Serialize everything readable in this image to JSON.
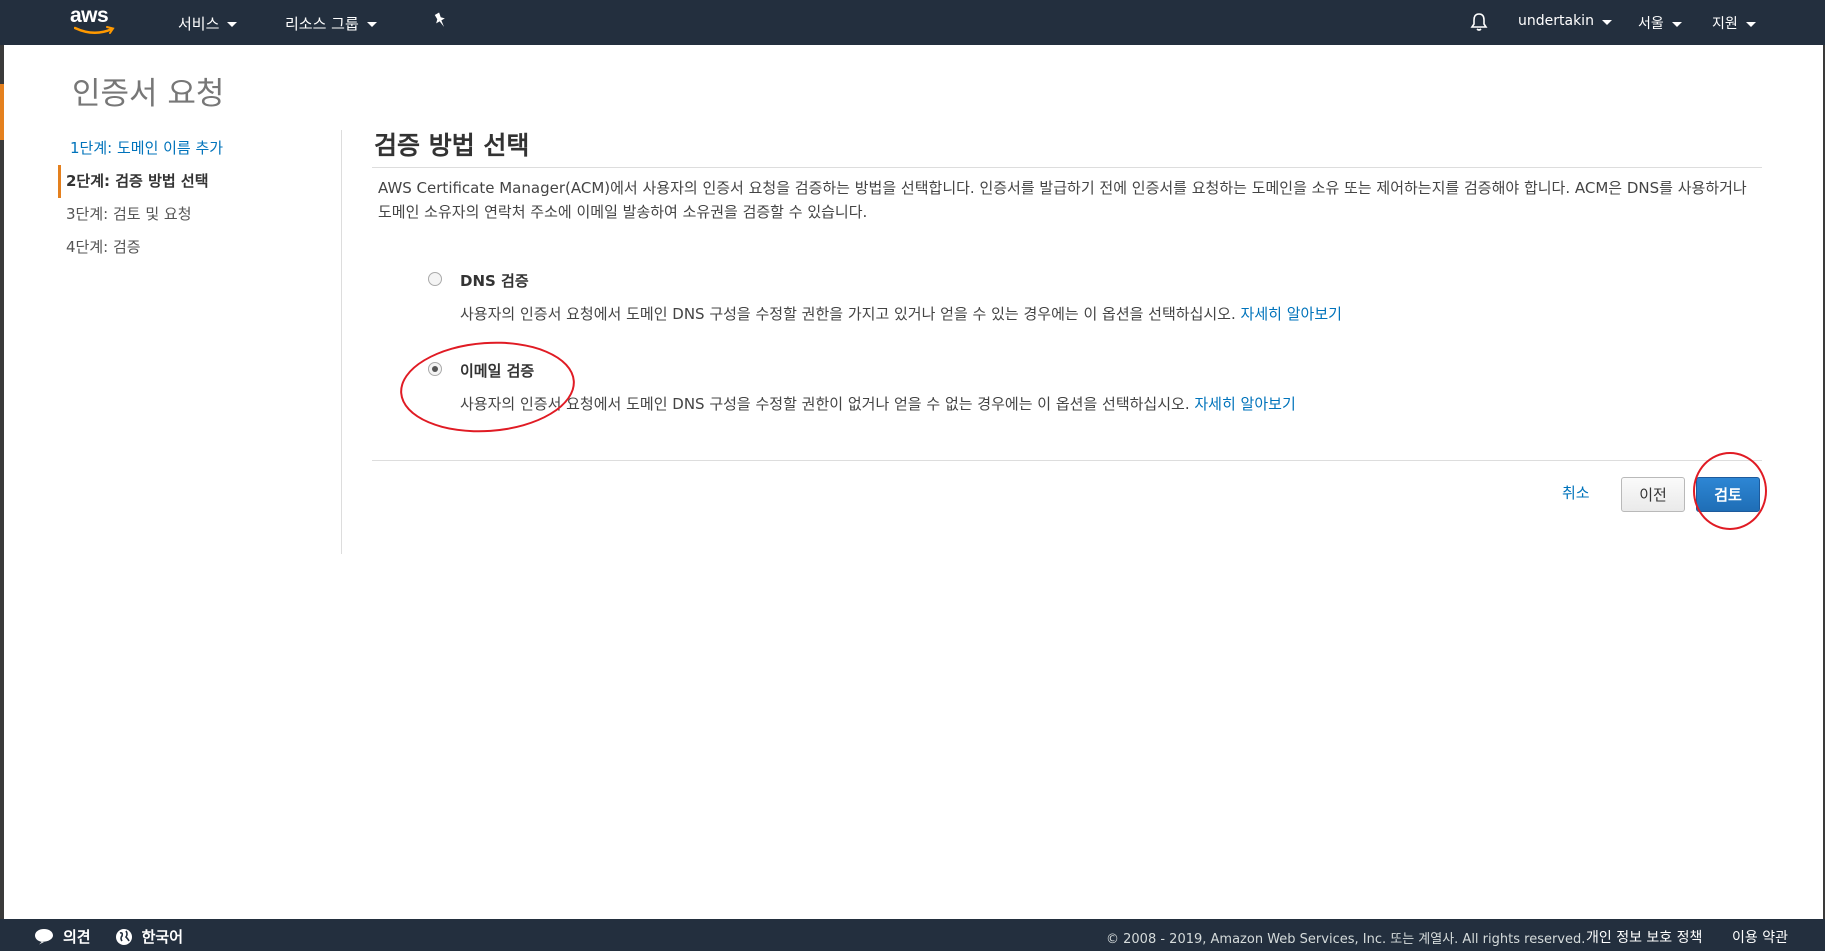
{
  "topbar": {
    "logo_text": "aws",
    "services_label": "서비스",
    "resource_groups_label": "리소스 그룹",
    "user_label": "undertakin",
    "region_label": "서울",
    "support_label": "지원",
    "icons": [
      "pin-icon",
      "bell-icon",
      "chevron-down-icon"
    ]
  },
  "page": {
    "title": "인증서 요청"
  },
  "steps": [
    {
      "label": "1단계: 도메인 이름 추가",
      "state": "link"
    },
    {
      "label": "2단계: 검증 방법 선택",
      "state": "active"
    },
    {
      "label": "3단계: 검토 및 요청",
      "state": "upcoming"
    },
    {
      "label": "4단계: 검증",
      "state": "upcoming"
    }
  ],
  "main": {
    "section_title": "검증 방법 선택",
    "description": "AWS Certificate Manager(ACM)에서 사용자의 인증서 요청을 검증하는 방법을 선택합니다. 인증서를 발급하기 전에 인증서를 요청하는 도메인을 소유 또는 제어하는지를 검증해야 합니다. ACM은 DNS를 사용하거나 도메인 소유자의 연락처 주소에 이메일 발송하여 소유권을 검증할 수 있습니다.",
    "options": [
      {
        "label": "DNS 검증",
        "description": "사용자의 인증서 요청에서 도메인 DNS 구성을 수정할 권한을 가지고 있거나 얻을 수 있는 경우에는 이 옵션을 선택하십시오.",
        "link": "자세히 알아보기",
        "selected": false
      },
      {
        "label": "이메일 검증",
        "description": "사용자의 인증서 요청에서 도메인 DNS 구성을 수정할 권한이 없거나 얻을 수 없는 경우에는 이 옵션을 선택하십시오.",
        "link": "자세히 알아보기",
        "selected": true
      }
    ],
    "actions": {
      "cancel": "취소",
      "previous": "이전",
      "review": "검토"
    }
  },
  "footer": {
    "feedback": "의견",
    "language": "한국어",
    "copyright": "© 2008 - 2019, Amazon Web Services, Inc. 또는 계열사. All rights reserved.",
    "privacy": "개인 정보 보호 정책",
    "terms": "이용 약관"
  },
  "colors": {
    "nav_bg": "#232f3e",
    "link": "#0073bb",
    "accent": "#e4801e",
    "primary_button": "#1f6eb6",
    "annotation": "#e01b24"
  }
}
